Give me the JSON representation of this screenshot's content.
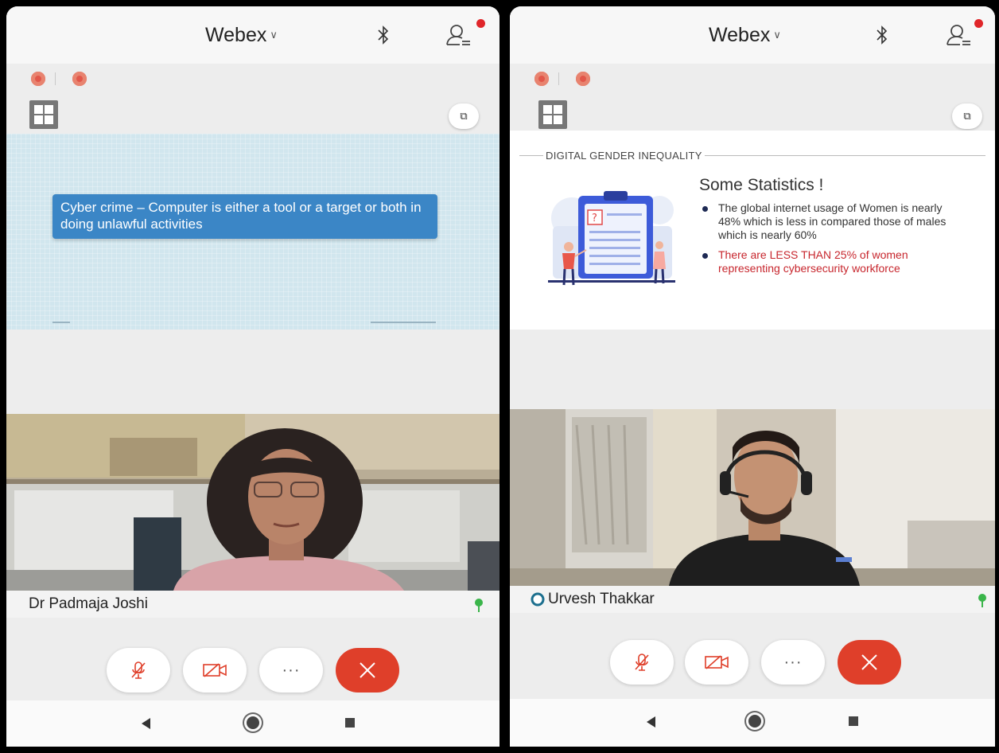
{
  "left_phone": {
    "app_title": "Webex",
    "slide": {
      "text": "Cyber crime – Computer is either a tool or a target or both in doing unlawful activities"
    },
    "participant_name": "Dr Padmaja Joshi",
    "icons": [
      "bluetooth-icon",
      "participants-icon",
      "record-icon",
      "grid-layout-icon",
      "closed-caption-icon",
      "mute-icon",
      "video-off-icon",
      "more-icon",
      "end-call-icon",
      "signal-icon"
    ]
  },
  "right_phone": {
    "app_title": "Webex",
    "slide": {
      "header": "DIGITAL GENDER INEQUALITY",
      "title": "Some Statistics !",
      "bullets": [
        "The global internet usage of Women is nearly 48% which is less in compared those of males which is nearly 60%",
        "There are LESS THAN 25% of women representing cybersecurity workforce"
      ],
      "highlight_color": "#c7262d"
    },
    "participant_name": "Urvesh Thakkar"
  },
  "controls": {
    "more_label": "···"
  },
  "colors": {
    "accent_red": "#df3f2a",
    "notification_dot": "#e0262a",
    "slide_callout": "#3b86c6"
  }
}
